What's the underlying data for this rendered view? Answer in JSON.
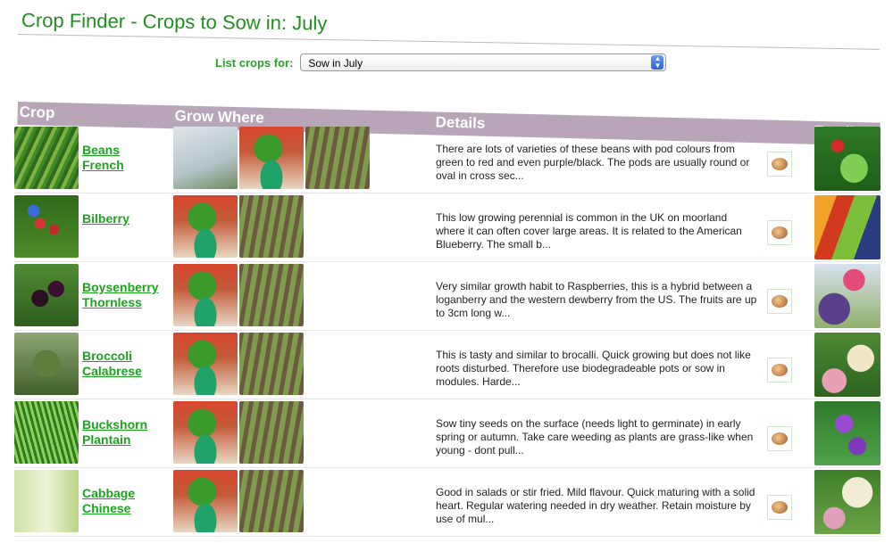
{
  "page": {
    "title": "Crop Finder - Crops to Sow in: July"
  },
  "filter": {
    "label": "List crops for:",
    "selected": "Sow in July"
  },
  "columns": {
    "crop": "Crop",
    "grow_where": "Grow Where",
    "details": "Details",
    "family": "Family"
  },
  "rows": [
    {
      "crop": [
        "Beans",
        "French"
      ],
      "details": "There are lots of varieties of these beans with pod colours from green to red and even purple/black. The pods are usually round or oval in cross sec..."
    },
    {
      "crop": [
        "Bilberry"
      ],
      "details": "This low growing perennial is common in the UK on moorland where it can often cover large areas. It is related to the American Blueberry. The small b..."
    },
    {
      "crop": [
        "Boysenberry",
        "Thornless"
      ],
      "details": "Very similar growth habit to Raspberries, this is a hybrid between a loganberry and the western dewberry from the US. The fruits are up to 3cm long w..."
    },
    {
      "crop": [
        "Broccoli",
        "Calabrese"
      ],
      "details": "This is tasty and similar to brocalli. Quick growing but does not like roots disturbed. Therefore use biodegradeable pots or sow in modules. Harde..."
    },
    {
      "crop": [
        "Buckshorn",
        "Plantain"
      ],
      "details": "Sow tiny seeds on the surface (needs light to germinate) in early spring or autumn. Take care weeding as plants are grass-like when young - dont pull..."
    },
    {
      "crop": [
        "Cabbage",
        "Chinese"
      ],
      "details": "Good in salads or stir fried. Mild flavour. Quick maturing with a solid heart. Regular watering needed in dry weather. Retain moisture by use of mul..."
    }
  ]
}
